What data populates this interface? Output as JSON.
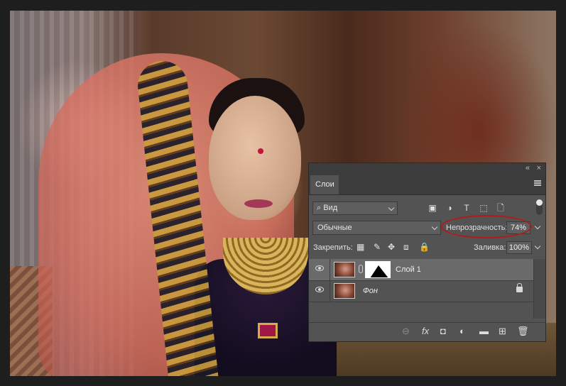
{
  "panel": {
    "top_controls": [
      "«",
      "×"
    ],
    "tab_label": "Слои",
    "menu_icon": "panel-menu-icon",
    "filter": {
      "label": "Вид",
      "icon": "search-icon"
    },
    "filter_icons": [
      "image-filter-icon",
      "adjustment-filter-icon",
      "type-filter-icon",
      "shape-filter-icon",
      "smart-object-filter-icon"
    ],
    "blend_mode": "Обычные",
    "opacity_label": "Непрозрачность:",
    "opacity_value": "74%",
    "lock_label": "Закрепить:",
    "lock_icons": [
      "lock-transparent-icon",
      "lock-image-icon",
      "lock-position-icon",
      "lock-artboard-icon",
      "lock-all-icon"
    ],
    "fill_label": "Заливка:",
    "fill_value": "100%",
    "layers": [
      {
        "name": "Слой 1",
        "selected": true,
        "has_mask": true,
        "locked": false
      },
      {
        "name": "Фон",
        "selected": false,
        "has_mask": false,
        "locked": true
      }
    ],
    "footer_icons": [
      "link-layers-icon",
      "fx-icon",
      "add-mask-icon",
      "adjustment-layer-icon",
      "group-folder-icon",
      "new-layer-icon",
      "delete-layer-icon"
    ],
    "footer_glyphs": [
      "⊖",
      "fx",
      "◘",
      "◐",
      "▬",
      "⊞",
      "🗑"
    ]
  },
  "colors": {
    "panel_bg": "#535353",
    "highlight_ellipse": "#b01c1c",
    "selected_row": "#6a6a6a"
  }
}
